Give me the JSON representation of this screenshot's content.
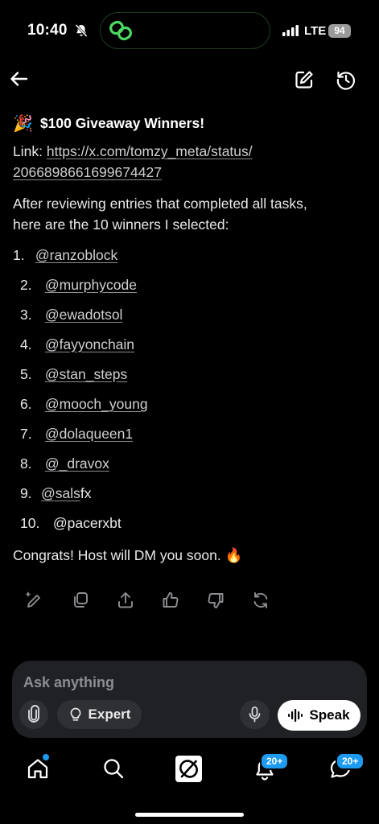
{
  "status_bar": {
    "time": "10:40",
    "network": "LTE",
    "battery": "94"
  },
  "post": {
    "title_emoji": "🎉",
    "title": "$100 Giveaway Winners!",
    "link_label": "Link:",
    "link_line1": "https://x.com/tomzy_meta/status/",
    "link_line2": "2066898661699674427",
    "intro_line1": "After reviewing entries that completed all tasks,",
    "intro_line2": "here are the 10 winners I selected:",
    "winners": [
      {
        "num": "1.",
        "handle": "@ranzoblock"
      },
      {
        "num": "2.",
        "handle": "@murphycode"
      },
      {
        "num": "3.",
        "handle": "@ewadotsol"
      },
      {
        "num": "4.",
        "handle": "@fayyonchain"
      },
      {
        "num": "5.",
        "handle": "@stan_steps"
      },
      {
        "num": "6.",
        "handle": "@mooch_young"
      },
      {
        "num": "7.",
        "handle": "@dolaqueen1"
      },
      {
        "num": "8.",
        "handle": "@_dravox"
      },
      {
        "num": "9.",
        "handle": "@sals",
        "suffix": "fx"
      },
      {
        "num": "10.",
        "handle": "@pacerxbt"
      }
    ],
    "closing": "Congrats! Host will DM you soon.",
    "closing_emoji": "🔥"
  },
  "composer": {
    "placeholder": "Ask anything",
    "expert_label": "Expert",
    "speak_label": "Speak"
  },
  "nav": {
    "notifications_badge": "20+",
    "messages_badge": "20+"
  },
  "colors": {
    "accent": "#1d9bf0",
    "island_icon": "#4cd964"
  }
}
